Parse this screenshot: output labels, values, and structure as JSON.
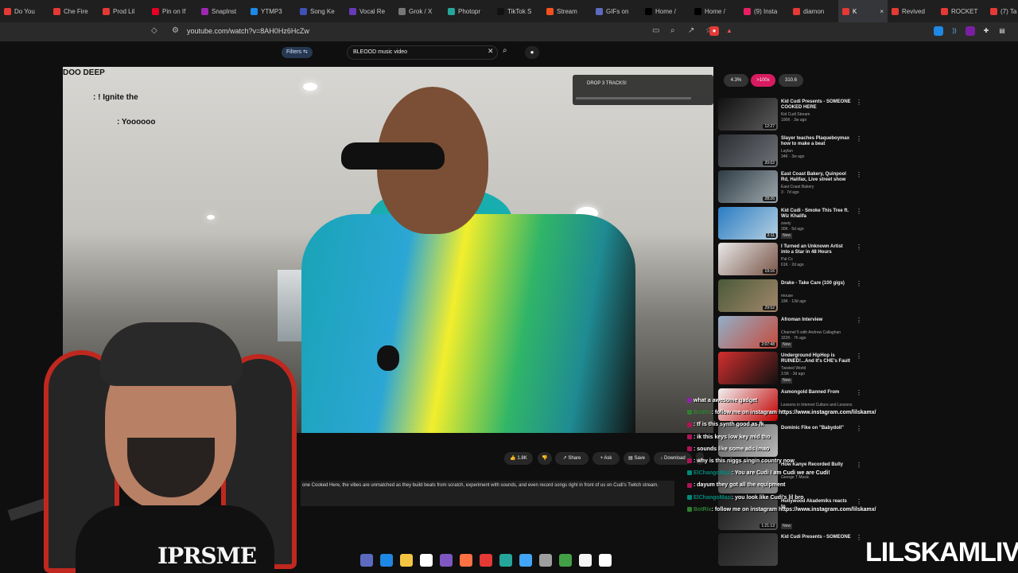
{
  "browser": {
    "tabs": [
      {
        "label": "Do You",
        "color": "#e53935"
      },
      {
        "label": "Che Fire",
        "color": "#e53935"
      },
      {
        "label": "Prod Lil",
        "color": "#e53935"
      },
      {
        "label": "Pin on If",
        "color": "#e60023"
      },
      {
        "label": "Snaplnst",
        "color": "#9c27b0"
      },
      {
        "label": "YTMP3",
        "color": "#1e88e5"
      },
      {
        "label": "Song Ke",
        "color": "#3f51b5"
      },
      {
        "label": "Vocal Re",
        "color": "#673ab7"
      },
      {
        "label": "Grok / X",
        "color": "#777777"
      },
      {
        "label": "Photopr",
        "color": "#26a69a"
      },
      {
        "label": "TikTok S",
        "color": "#111111"
      },
      {
        "label": "Stream",
        "color": "#f4511e"
      },
      {
        "label": "GIFs on",
        "color": "#5c6bc0"
      },
      {
        "label": "Home /",
        "color": "#000000"
      },
      {
        "label": "Home /",
        "color": "#000000"
      },
      {
        "label": "(9) Insta",
        "color": "#e91e63"
      },
      {
        "label": "diamon",
        "color": "#e53935"
      },
      {
        "label": "K",
        "color": "#e53935"
      },
      {
        "label": "Revived",
        "color": "#e53935"
      },
      {
        "label": "ROCKET",
        "color": "#e53935"
      },
      {
        "label": "(7) Ta",
        "color": "#e53935"
      }
    ],
    "active_tab_index": 17,
    "url": "youtube.com/watch?v=8AH0Hz6HcZw"
  },
  "youtube": {
    "filters_label": "Filters",
    "search_value": "BLEOOD music video",
    "chips": [
      {
        "label": "4.3%",
        "color": "#333333"
      },
      {
        "label": ">100x",
        "color": "#d81b60"
      },
      {
        "label": "310.6",
        "color": "#333333"
      }
    ],
    "video_overlay": {
      "title": "DOO DEEP",
      "line1": ": ! Ignite the",
      "line2": ": Yoooooo",
      "stream_card_title": "DROP 3 TRACKS!"
    },
    "actions": [
      {
        "label": "1.8K"
      },
      {
        "label": ""
      },
      {
        "label": "Share"
      },
      {
        "label": "Ask"
      },
      {
        "label": "Save"
      },
      {
        "label": "Download"
      },
      {
        "label": "..."
      }
    ],
    "description": "one Cooked Here, the vibes are unmatched as they build beats from scratch, experiment with sounds, and even record songs right in front of us on Cudi's Twitch stream.",
    "recommendations": [
      {
        "title": "Kid Cudi Presents - SOMEONE COOKED HERE",
        "channel": "Kid Cudi Stream",
        "meta": "100K · 3w ago",
        "duration": "12:27",
        "new": false,
        "colors": [
          "#111111",
          "#5b5b5b"
        ]
      },
      {
        "title": "Slayer teaches Plaqueboymax how to make a beat",
        "channel": "Laylan",
        "meta": "34K · 3w ago",
        "duration": "20:02",
        "new": false,
        "colors": [
          "#2b2f33",
          "#6e7177"
        ]
      },
      {
        "title": "East Coast Bakery, Quinpool Rd, Halifax, Live street show",
        "channel": "East Coast Bakery",
        "meta": "3 · 7d ago",
        "duration": "28:26",
        "new": false,
        "colors": [
          "#2f3c45",
          "#9da7ad"
        ]
      },
      {
        "title": "Kid Cudi - Smoke This Tree ft. Wiz Khalifa",
        "channel": "zweiy",
        "meta": "30K · 5d ago",
        "duration": "2:11",
        "new": true,
        "colors": [
          "#2a7cc4",
          "#b6d0e0"
        ]
      },
      {
        "title": "I Turned an Unknown Artist into a Star in 48 Hours",
        "channel": "Pat Cc",
        "meta": "61K · 2d ago",
        "duration": "19:16",
        "new": false,
        "colors": [
          "#e8e8e8",
          "#7a5548"
        ]
      },
      {
        "title": "Drake - Take Care (100 gigs)",
        "channel": "mouse",
        "meta": "19K · 13d ago",
        "duration": "29:52",
        "new": false,
        "colors": [
          "#4a5a3a",
          "#a2876a"
        ]
      },
      {
        "title": "Afroman Interview",
        "channel": "Channel 5 with Andrew Callaghan",
        "meta": "322K · 7h ago",
        "duration": "2:07:48",
        "new": true,
        "colors": [
          "#91b0c8",
          "#c64a3b"
        ]
      },
      {
        "title": "Underground HipHop is RUINED!...And It's CHE's Fault",
        "channel": "Twisted World",
        "meta": "3.5K · 3d ago",
        "duration": "",
        "new": true,
        "colors": [
          "#d32f2f",
          "#111111"
        ]
      },
      {
        "title": "Asmongold Banned From",
        "channel": "Lessons in Internet Culture and Lessons",
        "meta": "",
        "duration": "",
        "new": false,
        "colors": [
          "#f2f2f2",
          "#c00000"
        ]
      },
      {
        "title": "Dominic Fike on \"Babydoll\"",
        "channel": "",
        "meta": "",
        "duration": "",
        "new": false,
        "colors": [
          "#555555",
          "#bbbbbb"
        ]
      },
      {
        "title": "How Kanye Recorded Bully",
        "channel": "George T Music",
        "meta": "",
        "duration": "",
        "new": false,
        "colors": [
          "#3e3e3e",
          "#8b8b8b"
        ]
      },
      {
        "title": "Hollywood Akademiks reacts to",
        "channel": "",
        "meta": "",
        "duration": "1:21:13",
        "new": true,
        "colors": [
          "#1a1a1a",
          "#555555"
        ]
      },
      {
        "title": "Kid Cudi Presents - SOMEONE",
        "channel": "",
        "meta": "",
        "duration": "",
        "new": false,
        "colors": [
          "#202020",
          "#444444"
        ]
      }
    ]
  },
  "stream_chat": [
    {
      "user": "",
      "message": "what a awesome gadget",
      "color": "#8e24aa"
    },
    {
      "user": "BotRix",
      "message": ": follow me on instagram https://www.instagram.com/lilskamx/",
      "color": "#2e7d32"
    },
    {
      "user": "",
      "message": ": tf is this synth good as fk",
      "color": "#ad1457"
    },
    {
      "user": "",
      "message": ": ik this keys low key mid tho",
      "color": "#ad1457"
    },
    {
      "user": "",
      "message": ": sounds like some ads lmao",
      "color": "#ad1457"
    },
    {
      "user": "",
      "message": ": why is this niggs singin country now",
      "color": "#ad1457"
    },
    {
      "user": "ElChangoMazi",
      "message": ": You are Cudi I am Cudi we are Cudi!",
      "color": "#00897b"
    },
    {
      "user": "",
      "message": ": dayum they got all the equipment",
      "color": "#ad1457"
    },
    {
      "user": "ElChangoMazi",
      "message": ": you look like Cudi's lil bro",
      "color": "#00897b"
    },
    {
      "user": "BotRix",
      "message": ": follow me on instagram https://www.instagram.com/lilskamx/",
      "color": "#2e7d32"
    }
  ],
  "webcam": {
    "shirt_text": "IPRSME",
    "watermark": "LILSKAMLIVE"
  },
  "taskbar_icons": [
    "#5c6bc0",
    "#1e88e5",
    "#f4c542",
    "#ffffff",
    "#7e57c2",
    "#ff7043",
    "#e53935",
    "#26a69a",
    "#42a5f5",
    "#9e9e9e",
    "#43a047",
    "#f5f5f5",
    "#ffffff"
  ]
}
